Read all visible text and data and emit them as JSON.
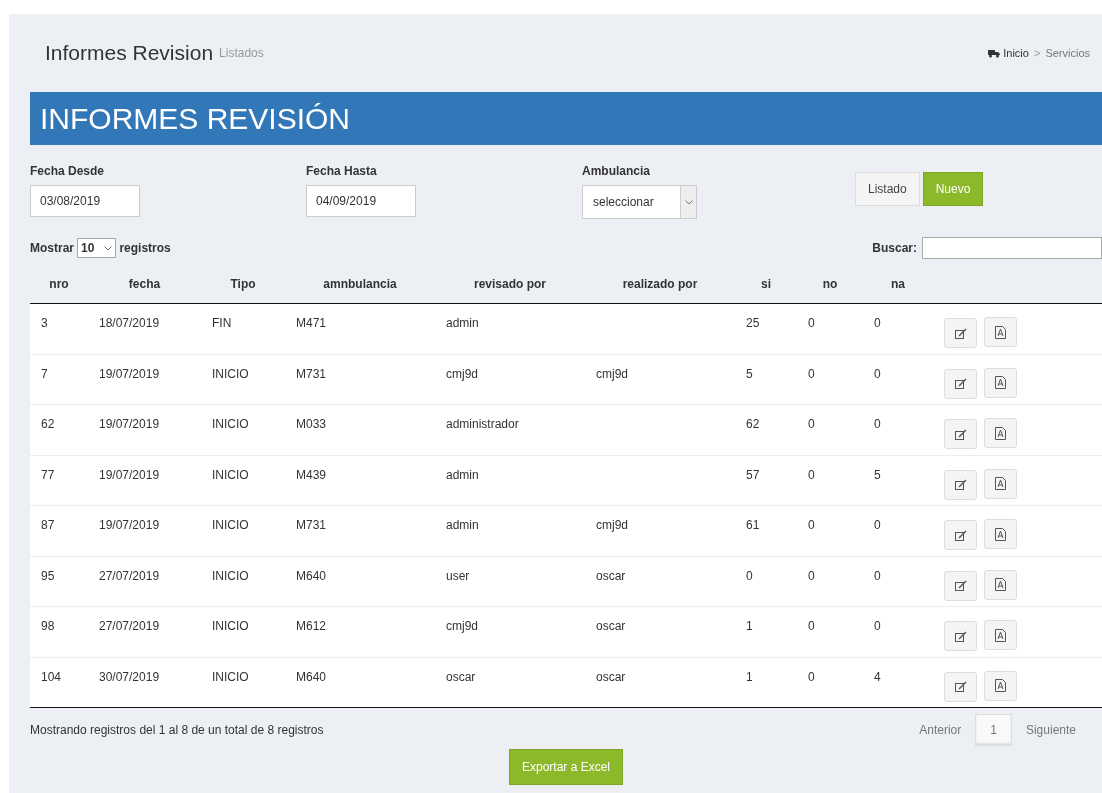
{
  "header": {
    "title": "Informes Revision",
    "subtitle": "Listados"
  },
  "breadcrumb": [
    {
      "label": "Inicio",
      "icon": true
    },
    {
      "label": "Servicios",
      "icon": false
    }
  ],
  "breadcrumb_separator": ">",
  "banner": "INFORMES REVISIÓN",
  "filters": [
    {
      "kind": "date",
      "label": "Fecha Desde",
      "value": "03/08/2019"
    },
    {
      "kind": "date",
      "label": "Fecha Hasta",
      "value": "04/09/2019"
    },
    {
      "kind": "select",
      "label": "Ambulancia",
      "value": "seleccionar"
    }
  ],
  "buttons": [
    {
      "label": "Listado",
      "kind": "default"
    },
    {
      "label": "Nuevo",
      "kind": "success"
    }
  ],
  "length": {
    "before": "Mostrar",
    "value": "10",
    "after": "registros"
  },
  "search": {
    "label": "Buscar:"
  },
  "table": {
    "columns": [
      "nro",
      "fecha",
      "Tipo",
      "amnbulancia",
      "revisado por",
      "realizado por",
      "si",
      "no",
      "na"
    ],
    "rows": [
      [
        "3",
        "18/07/2019",
        "FIN",
        "M471",
        "admin",
        "",
        "25",
        "0",
        "0"
      ],
      [
        "7",
        "19/07/2019",
        "INICIO",
        "M731",
        "cmj9d",
        "cmj9d",
        "5",
        "0",
        "0"
      ],
      [
        "62",
        "19/07/2019",
        "INICIO",
        "M033",
        "administrador",
        "",
        "62",
        "0",
        "0"
      ],
      [
        "77",
        "19/07/2019",
        "INICIO",
        "M439",
        "admin",
        "",
        "57",
        "0",
        "5"
      ],
      [
        "87",
        "19/07/2019",
        "INICIO",
        "M731",
        "admin",
        "cmj9d",
        "61",
        "0",
        "0"
      ],
      [
        "95",
        "27/07/2019",
        "INICIO",
        "M640",
        "user",
        "oscar",
        "0",
        "0",
        "0"
      ],
      [
        "98",
        "27/07/2019",
        "INICIO",
        "M612",
        "cmj9d",
        "oscar",
        "1",
        "0",
        "0"
      ],
      [
        "104",
        "30/07/2019",
        "INICIO",
        "M640",
        "oscar",
        "oscar",
        "1",
        "0",
        "4"
      ]
    ]
  },
  "info": "Mostrando registros del 1 al 8 de un total de 8 registros",
  "pagination": {
    "previous": "Anterior",
    "pages": [
      {
        "label": "1",
        "selected": true
      }
    ],
    "next": "Siguiente"
  },
  "export_button": "Exportar a Excel"
}
